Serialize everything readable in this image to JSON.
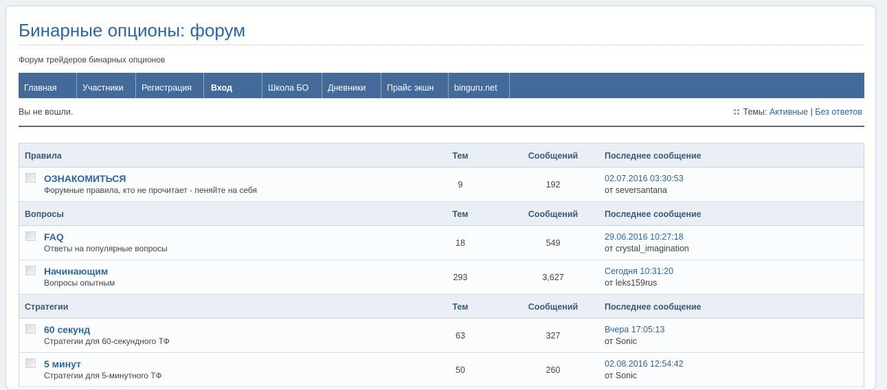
{
  "header": {
    "title": "Бинарные опционы: форум",
    "description": "Форум трейдеров бинарных опционов"
  },
  "nav": [
    {
      "label": "Главная",
      "bold": false
    },
    {
      "label": "Участники",
      "bold": false
    },
    {
      "label": "Регистрация",
      "bold": false
    },
    {
      "label": "Вход",
      "bold": true
    },
    {
      "label": "Школа БО",
      "bold": false
    },
    {
      "label": "Дневники",
      "bold": false
    },
    {
      "label": "Прайс экшн",
      "bold": false
    },
    {
      "label": "binguru.net",
      "bold": false
    }
  ],
  "status": {
    "login": "Вы не вошли.",
    "topics_label": "Темы:",
    "active_link": "Активные",
    "separator": "|",
    "unanswered_link": "Без ответов"
  },
  "columns": {
    "topics": "Тем",
    "posts": "Сообщений",
    "last_post": "Последнее сообщение"
  },
  "categories": [
    {
      "name": "Правила",
      "forums": [
        {
          "name": "ОЗНАКОМИТЬСЯ",
          "description": "Форумные правила, кто не прочитает - пеняйте на себя",
          "topics": "9",
          "posts": "192",
          "last_date": "02.07.2016 03:30:53",
          "last_by": "от seversantana"
        }
      ]
    },
    {
      "name": "Вопросы",
      "forums": [
        {
          "name": "FAQ",
          "description": "Ответы на популярные вопросы",
          "topics": "18",
          "posts": "549",
          "last_date": "29.06.2016 10:27:18",
          "last_by": "от crystal_imagination"
        },
        {
          "name": "Начинающим",
          "description": "Вопросы опытным",
          "topics": "293",
          "posts": "3,627",
          "last_date": "Сегодня 10:31:20",
          "last_by": "от leks159rus"
        }
      ]
    },
    {
      "name": "Стратегии",
      "forums": [
        {
          "name": "60 секунд",
          "description": "Стратегии для 60-секундного ТФ",
          "topics": "63",
          "posts": "327",
          "last_date": "Вчера 17:05:13",
          "last_by": "от Sonic"
        },
        {
          "name": "5 минут",
          "description": "Стратегии для 5-минутного ТФ",
          "topics": "50",
          "posts": "260",
          "last_date": "02.08.2016 12:54:42",
          "last_by": "от Sonic"
        }
      ]
    }
  ]
}
